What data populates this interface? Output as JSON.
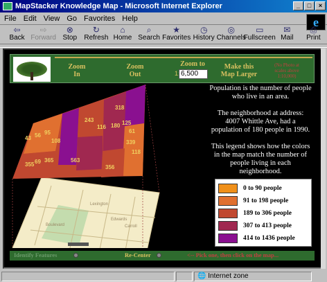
{
  "window": {
    "title": "MapStacker Knowledge Map - Microsoft Internet Explorer",
    "controls": [
      "_",
      "□",
      "×"
    ]
  },
  "menu": [
    "File",
    "Edit",
    "View",
    "Go",
    "Favorites",
    "Help"
  ],
  "toolbar": [
    {
      "label": "Back",
      "icon": "⇦",
      "enabled": true
    },
    {
      "label": "Forward",
      "icon": "⇨",
      "enabled": false
    },
    {
      "label": "Stop",
      "icon": "⊗",
      "enabled": true
    },
    {
      "label": "Refresh",
      "icon": "↻",
      "enabled": true
    },
    {
      "label": "Home",
      "icon": "⌂",
      "enabled": true
    },
    {
      "label": "Search",
      "icon": "⌕",
      "enabled": true
    },
    {
      "label": "Favorites",
      "icon": "★",
      "enabled": true
    },
    {
      "label": "History",
      "icon": "◷",
      "enabled": true
    },
    {
      "label": "Channels",
      "icon": "◎",
      "enabled": true
    },
    {
      "label": "Fullscreen",
      "icon": "▭",
      "enabled": true
    },
    {
      "label": "Mail",
      "icon": "✉",
      "enabled": true
    },
    {
      "label": "Print",
      "icon": "⎙",
      "enabled": true
    }
  ],
  "nav": {
    "zoom_in": "Zoom\nIn",
    "zoom_out": "Zoom\nOut",
    "zoom_to": "Zoom to",
    "zoom_value": "6,500",
    "zoom_prefix": "1:",
    "make_larger": "Make this\nMap Larger",
    "photo_note": "(No Photo at\nscales above\n1:10,000)"
  },
  "map": {
    "labels": [
      "43",
      "56",
      "95",
      "108",
      "243",
      "116",
      "180",
      "125",
      "355",
      "69",
      "365",
      "563",
      "339",
      "118",
      "356",
      "318",
      "61"
    ],
    "street_labels": [
      "Lexington",
      "Edwards",
      "Carroll",
      "Boulevard"
    ]
  },
  "info": {
    "p1": "Population is the number of people who live in an area.",
    "p2": "The neighborhood at address: 4007 Whittle Ave, had a population of 180 people in 1990.",
    "p3": "This legend shows how the colors in the map match the number of people living in each neighborhood."
  },
  "legend": [
    {
      "label": "0 to 90 people",
      "color": "#f0901a"
    },
    {
      "label": "91 to 198 people",
      "color": "#e07030"
    },
    {
      "label": "189 to 306 people",
      "color": "#c04830"
    },
    {
      "label": "307 to 413 people",
      "color": "#a02850"
    },
    {
      "label": "414 to 1436 people",
      "color": "#8a1090"
    }
  ],
  "bottom": {
    "identify": "Identify Features",
    "recenter": "Re-Center",
    "hint": "<-- Pick one, then click on the map..."
  },
  "status": {
    "zone": "Internet zone"
  }
}
